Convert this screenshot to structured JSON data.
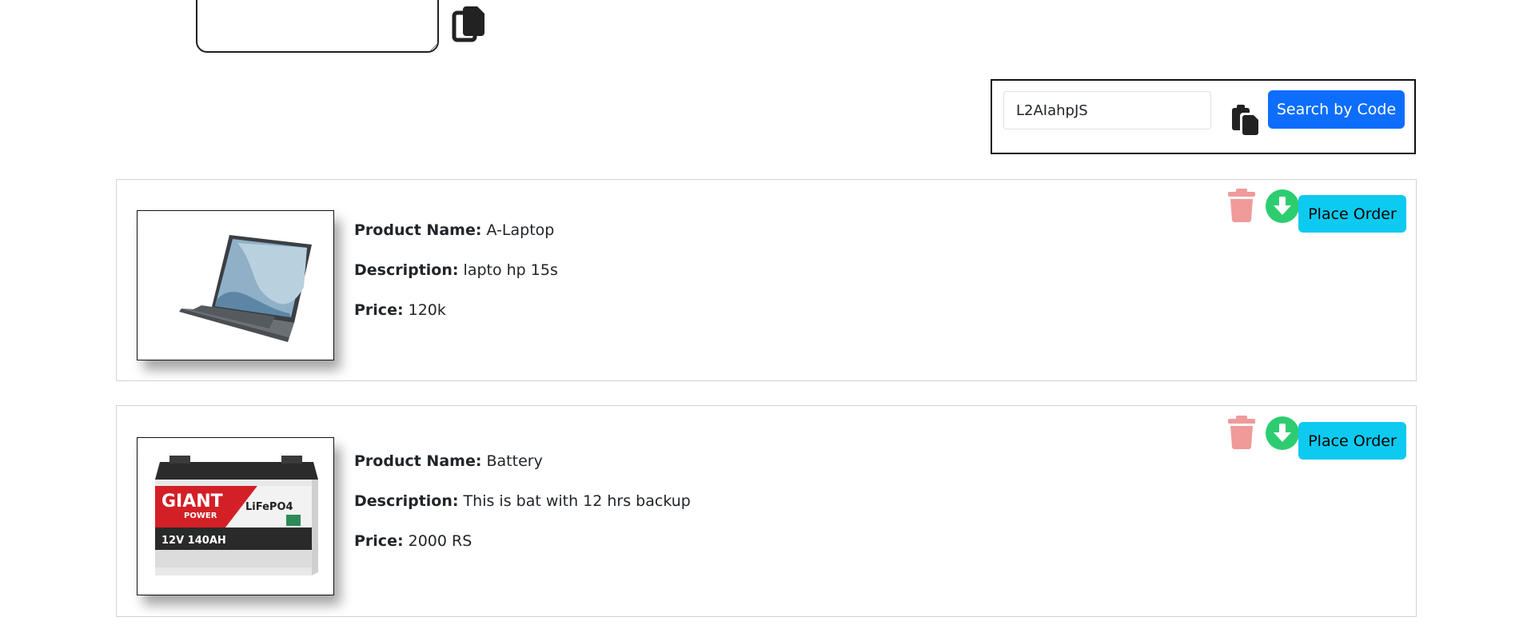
{
  "top": {
    "textarea_value": "",
    "copy_icon": "copy-icon"
  },
  "search": {
    "value": "L2AIahpJS",
    "paste_icon": "paste-icon",
    "button_label": "Search by Code"
  },
  "products": [
    {
      "image": "laptop",
      "name_label": "Product Name:",
      "name": "A-Laptop",
      "description_label": "Description:",
      "description": "lapto hp 15s",
      "price_label": "Price:",
      "price": "120k",
      "delete_icon": "trash-icon",
      "download_icon": "download-icon",
      "order_label": "Place Order"
    },
    {
      "image": "battery",
      "brand_text": "GIANT",
      "brand_sub": "POWER",
      "chem_text": "LiFePO4",
      "spec_text": "12V 140AH",
      "name_label": "Product Name:",
      "name": "Battery",
      "description_label": "Description:",
      "description": "This is bat with 12 hrs backup",
      "price_label": "Price:",
      "price": "2000 RS",
      "delete_icon": "trash-icon",
      "download_icon": "download-icon",
      "order_label": "Place Order"
    }
  ],
  "colors": {
    "primary": "#0d6efd",
    "info": "#0dcaf0",
    "delete": "#f09a9a",
    "download": "#2ecc71"
  }
}
